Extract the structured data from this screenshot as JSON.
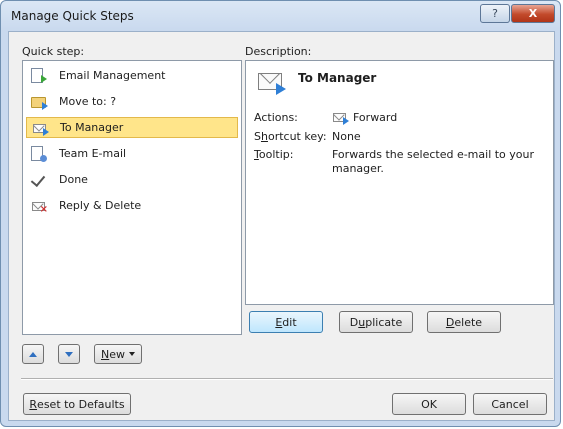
{
  "window": {
    "title": "Manage Quick Steps",
    "help_glyph": "?",
    "close_glyph": "X"
  },
  "quick_step_label_pre": "Q",
  "quick_step_label_post": "uick step:",
  "description_label": "Description:",
  "list": [
    {
      "label": "Email Management",
      "icon": "email-management-icon",
      "selected": false
    },
    {
      "label": "Move to: ?",
      "icon": "move-to-folder-icon",
      "selected": false
    },
    {
      "label": "To Manager",
      "icon": "forward-email-icon",
      "selected": true
    },
    {
      "label": "Team E-mail",
      "icon": "team-email-icon",
      "selected": false
    },
    {
      "label": "Done",
      "icon": "checkmark-icon",
      "selected": false
    },
    {
      "label": "Reply & Delete",
      "icon": "reply-delete-icon",
      "selected": false
    }
  ],
  "detail": {
    "name": "To Manager",
    "actions_label": "Actions:",
    "action_value": "Forward",
    "shortcut_label_pre": "S",
    "shortcut_label_u": "h",
    "shortcut_label_post": "ortcut key:",
    "shortcut_value": "None",
    "tooltip_label_u": "T",
    "tooltip_label_post": "ooltip:",
    "tooltip_value": "Forwards the selected e-mail to your manager."
  },
  "buttons": {
    "edit_u": "E",
    "edit_rest": "dit",
    "duplicate_pre": "D",
    "duplicate_u": "u",
    "duplicate_rest": "plicate",
    "delete_u": "D",
    "delete_rest": "elete",
    "new_u": "N",
    "new_rest": "ew",
    "reset_u": "R",
    "reset_rest": "eset to Defaults",
    "ok": "OK",
    "cancel": "Cancel"
  },
  "colors": {
    "selection": "#ffe58a",
    "title_gradient": "#c9d9ee",
    "close": "#c24a2b"
  }
}
